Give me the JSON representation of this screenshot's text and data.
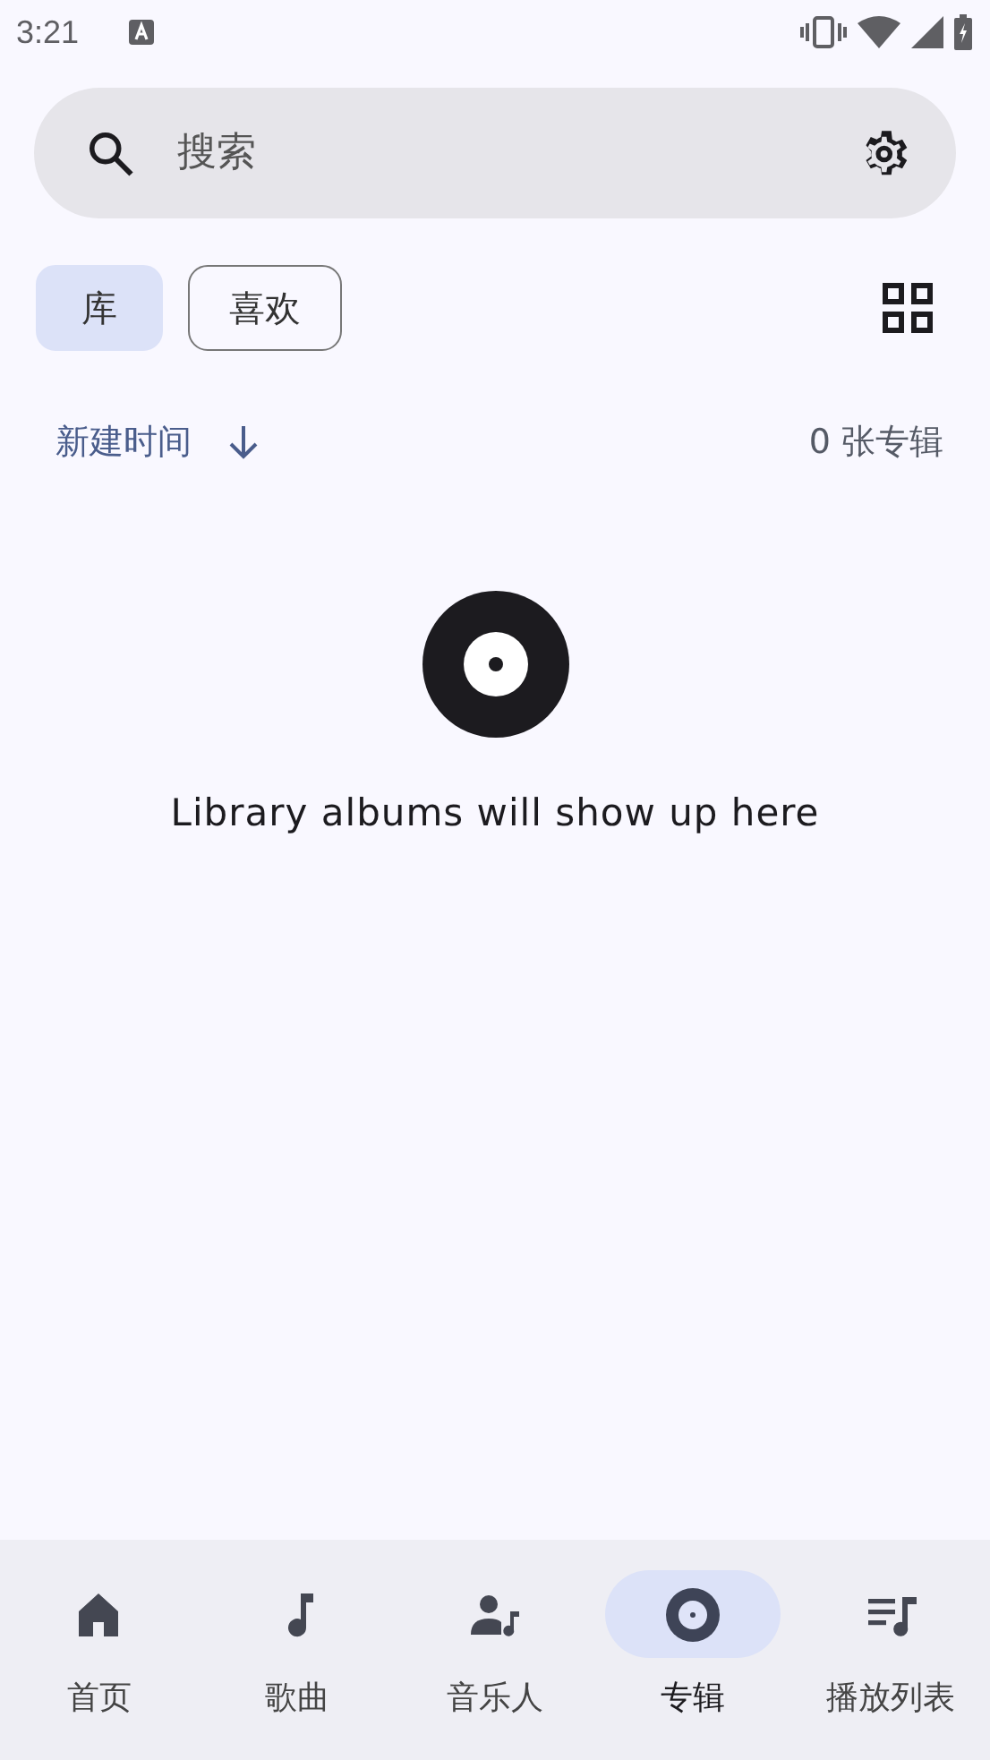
{
  "status_bar": {
    "time": "3:21"
  },
  "search": {
    "placeholder": "搜索"
  },
  "filters": [
    {
      "label": "库",
      "selected": true
    },
    {
      "label": "喜欢",
      "selected": false
    }
  ],
  "sort": {
    "label": "新建时间"
  },
  "count": "0 张专辑",
  "empty_message": "Library albums will show up here",
  "nav": [
    {
      "kind": "home",
      "label": "首页",
      "selected": false
    },
    {
      "kind": "songs",
      "label": "歌曲",
      "selected": false
    },
    {
      "kind": "artists",
      "label": "音乐人",
      "selected": false
    },
    {
      "kind": "albums",
      "label": "专辑",
      "selected": true
    },
    {
      "kind": "playlists",
      "label": "播放列表",
      "selected": false
    }
  ]
}
